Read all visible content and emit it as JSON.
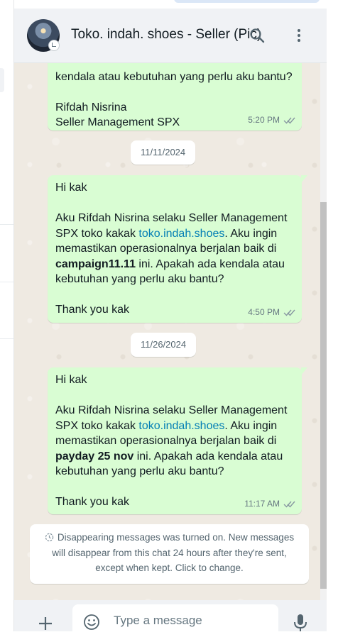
{
  "header": {
    "title": "Toko. indah. shoes - Seller (Pic)"
  },
  "messages": [
    {
      "date": "",
      "paragraphs": [
        "kendala atau kebutuhan yang perlu aku bantu?",
        "Rifdah Nisrina",
        "Seller Management SPX"
      ],
      "time": "5:20 PM"
    },
    {
      "date": "11/11/2024",
      "greeting": "Hi kak",
      "intro": "Aku Rifdah Nisrina selaku Seller Management SPX toko kakak ",
      "link": "toko.indah.shoes",
      "mid": ". Aku ingin memastikan operasionalnya berjalan baik di ",
      "bold": "campaign11.11",
      "outro": " ini. Apakah ada kendala atau kebutuhan yang perlu aku bantu?",
      "closing": "Thank you kak",
      "time": "4:50 PM"
    },
    {
      "date": "11/26/2024",
      "greeting": "Hi kak",
      "intro": "Aku Rifdah Nisrina selaku Seller Management SPX toko kakak ",
      "link": "toko.indah.shoes",
      "mid": ". Aku ingin memastikan operasionalnya berjalan baik di ",
      "bold": "payday 25 nov",
      "outro": " ini. Apakah ada kendala atau kebutuhan yang perlu aku bantu?",
      "closing": "Thank you kak",
      "time": "11:17 AM"
    }
  ],
  "system_note": "Disappearing messages was turned on. New messages will disappear from this chat 24 hours after they're sent, except when kept. Click to change.",
  "composer": {
    "placeholder": "Type a message"
  },
  "colors": {
    "bubble_out": "#d9fdd3",
    "chat_bg": "#efeae2",
    "link": "#027eb5",
    "meta": "#667781"
  },
  "icons": [
    "search-icon",
    "menu-icon",
    "double-check-icon",
    "timer-icon",
    "plus-icon",
    "emoji-icon",
    "mic-icon"
  ]
}
